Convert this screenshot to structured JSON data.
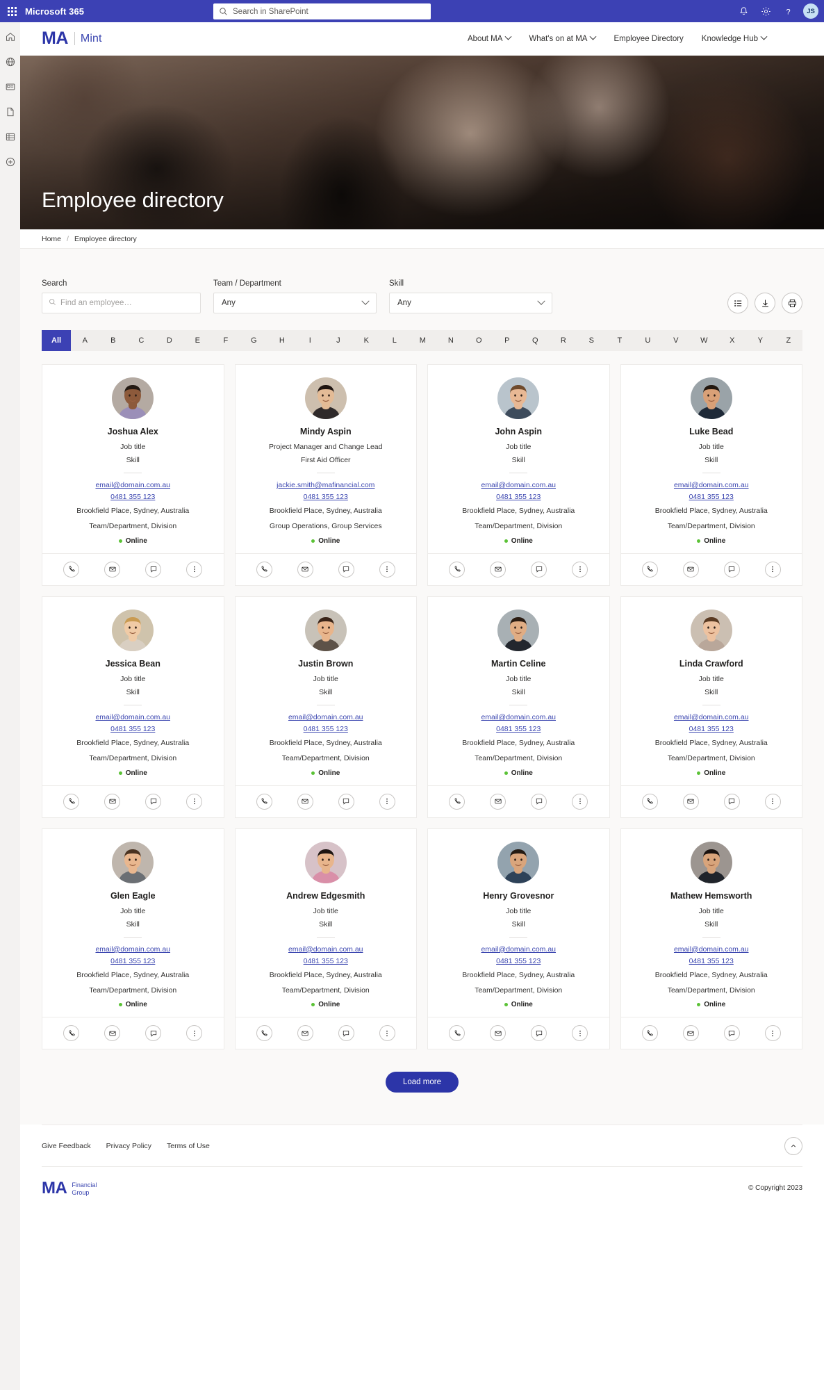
{
  "suitebar": {
    "brand": "Microsoft 365",
    "search_placeholder": "Search in SharePoint",
    "icons": {
      "waffle": "app-launcher-icon",
      "search": "search-icon",
      "bell": "notifications-icon",
      "gear": "settings-icon",
      "help": "help-icon"
    },
    "avatar_initials": "JS"
  },
  "rail": {
    "items": [
      {
        "name": "home-icon"
      },
      {
        "name": "globe-icon"
      },
      {
        "name": "news-icon"
      },
      {
        "name": "document-icon"
      },
      {
        "name": "list-icon"
      },
      {
        "name": "create-icon"
      }
    ]
  },
  "sitehdr": {
    "logo_ma": "MA",
    "logo_site": "Mint",
    "nav": [
      {
        "label": "About MA",
        "has_chevron": true
      },
      {
        "label": "What's on at MA",
        "has_chevron": true
      },
      {
        "label": "Employee Directory",
        "has_chevron": false
      },
      {
        "label": "Knowledge Hub",
        "has_chevron": true
      }
    ]
  },
  "hero": {
    "title": "Employee directory"
  },
  "breadcrumb": {
    "home": "Home",
    "separator": "/",
    "current": "Employee directory"
  },
  "filters": {
    "search_label": "Search",
    "search_value": "",
    "search_placeholder": "Find an employee…",
    "team_label": "Team / Department",
    "team_value": "Any",
    "skill_label": "Skill",
    "skill_value": "Any",
    "actions": [
      {
        "name": "list-view-icon"
      },
      {
        "name": "download-icon"
      },
      {
        "name": "print-icon"
      }
    ]
  },
  "alphabet": {
    "all_label": "All",
    "active": "All",
    "letters": [
      "A",
      "B",
      "C",
      "D",
      "E",
      "F",
      "G",
      "H",
      "I",
      "J",
      "K",
      "L",
      "M",
      "N",
      "O",
      "P",
      "Q",
      "R",
      "S",
      "T",
      "U",
      "V",
      "W",
      "X",
      "Y",
      "Z"
    ]
  },
  "cards": [
    {
      "name": "Joshua Alex",
      "job": "Job title",
      "skill": "Skill",
      "email": "email@domain.com.au",
      "phone": "0481 355 123",
      "location": "Brookfield Place, Sydney, Australia",
      "team": "Team/Department, Division",
      "status": "Online",
      "avatar_bg": "#b4aaa2",
      "skin": "#8d5a3b",
      "hair": "#241a13",
      "shirt": "#9b8fb8"
    },
    {
      "name": "Mindy Aspin",
      "job": "Project Manager and Change Lead",
      "skill": "First Aid Officer",
      "email": "jackie.smith@mafinancial.com",
      "phone": "0481 355 123",
      "location": "Brookfield Place, Sydney, Australia",
      "team": "Group Operations, Group Services",
      "status": "Online",
      "avatar_bg": "#cdbfae",
      "skin": "#e3bb96",
      "hair": "#1e1410",
      "shirt": "#2f2a2a"
    },
    {
      "name": "John Aspin",
      "job": "Job title",
      "skill": "Skill",
      "email": "email@domain.com.au",
      "phone": "0481 355 123",
      "location": "Brookfield Place, Sydney, Australia",
      "team": "Team/Department, Division",
      "status": "Online",
      "avatar_bg": "#b9c4cc",
      "skin": "#e8b894",
      "hair": "#6f4b2d",
      "shirt": "#3d4b5c"
    },
    {
      "name": "Luke Bead",
      "job": "Job title",
      "skill": "Skill",
      "email": "email@domain.com.au",
      "phone": "0481 355 123",
      "location": "Brookfield Place, Sydney, Australia",
      "team": "Team/Department, Division",
      "status": "Online",
      "avatar_bg": "#9aa3a8",
      "skin": "#d9a077",
      "hair": "#22170f",
      "shirt": "#1f2a38"
    },
    {
      "name": "Jessica Bean",
      "job": "Job title",
      "skill": "Skill",
      "email": "email@domain.com.au",
      "phone": "0481 355 123",
      "location": "Brookfield Place, Sydney, Australia",
      "team": "Team/Department, Division",
      "status": "Online",
      "avatar_bg": "#cfc3ac",
      "skin": "#f0cba6",
      "hair": "#c99b52",
      "shirt": "#d9cfc2"
    },
    {
      "name": "Justin Brown",
      "job": "Job title",
      "skill": "Skill",
      "email": "email@domain.com.au",
      "phone": "0481 355 123",
      "location": "Brookfield Place, Sydney, Australia",
      "team": "Team/Department, Division",
      "status": "Online",
      "avatar_bg": "#c8c2b8",
      "skin": "#e8b58c",
      "hair": "#3a2418",
      "shirt": "#5d5248"
    },
    {
      "name": "Martin Celine",
      "job": "Job title",
      "skill": "Skill",
      "email": "email@domain.com.au",
      "phone": "0481 355 123",
      "location": "Brookfield Place, Sydney, Australia",
      "team": "Team/Department, Division",
      "status": "Online",
      "avatar_bg": "#a8b0b4",
      "skin": "#e0ad84",
      "hair": "#2b1c12",
      "shirt": "#23272e"
    },
    {
      "name": "Linda Crawford",
      "job": "Job title",
      "skill": "Skill",
      "email": "email@domain.com.au",
      "phone": "0481 355 123",
      "location": "Brookfield Place, Sydney, Australia",
      "team": "Team/Department, Division",
      "status": "Online",
      "avatar_bg": "#cbbfb2",
      "skin": "#edc2a0",
      "hair": "#5a3a22",
      "shirt": "#b9a79a"
    },
    {
      "name": "Glen Eagle",
      "job": "Job title",
      "skill": "Skill",
      "email": "email@domain.com.au",
      "phone": "0481 355 123",
      "location": "Brookfield Place, Sydney, Australia",
      "team": "Team/Department, Division",
      "status": "Online",
      "avatar_bg": "#bfb6ad",
      "skin": "#e9b78f",
      "hair": "#4a3322",
      "shirt": "#6b6f74"
    },
    {
      "name": "Andrew Edgesmith",
      "job": "Job title",
      "skill": "Skill",
      "email": "email@domain.com.au",
      "phone": "0481 355 123",
      "location": "Brookfield Place, Sydney, Australia",
      "team": "Team/Department, Division",
      "status": "Online",
      "avatar_bg": "#d7c2c8",
      "skin": "#e8b58c",
      "hair": "#1d1512",
      "shirt": "#d98fa8"
    },
    {
      "name": "Henry Grovesnor",
      "job": "Job title",
      "skill": "Skill",
      "email": "email@domain.com.au",
      "phone": "0481 355 123",
      "location": "Brookfield Place, Sydney, Australia",
      "team": "Team/Department, Division",
      "status": "Online",
      "avatar_bg": "#93a3ae",
      "skin": "#d9a57c",
      "hair": "#241a12",
      "shirt": "#2e4258"
    },
    {
      "name": "Mathew Hemsworth",
      "job": "Job title",
      "skill": "Skill",
      "email": "email@domain.com.au",
      "phone": "0481 355 123",
      "location": "Brookfield Place, Sydney, Australia",
      "team": "Team/Department, Division",
      "status": "Online",
      "avatar_bg": "#9c9590",
      "skin": "#d8a47b",
      "hair": "#191210",
      "shirt": "#20242b"
    }
  ],
  "card_actions": [
    {
      "name": "phone-icon"
    },
    {
      "name": "email-icon"
    },
    {
      "name": "chat-icon"
    },
    {
      "name": "more-options-icon"
    }
  ],
  "load_more": {
    "label": "Load more"
  },
  "footer": {
    "links": [
      {
        "label": "Give Feedback"
      },
      {
        "label": "Privacy Policy"
      },
      {
        "label": "Terms of Use"
      }
    ],
    "to_top_icon": "chevron-up-icon",
    "logo_ma": "MA",
    "logo_line1": "Financial",
    "logo_line2": "Group",
    "copyright": "© Copyright 2023"
  },
  "colors": {
    "accent": "#3c41b4",
    "brand": "#2c35a8",
    "online": "#5bc236",
    "link": "#3b46b0"
  }
}
